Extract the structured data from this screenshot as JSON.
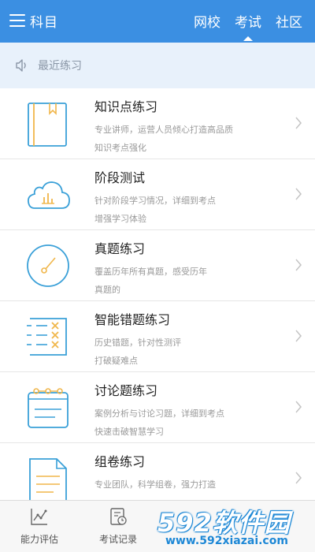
{
  "header": {
    "menu_label": "科目",
    "tabs": [
      {
        "label": "网校"
      },
      {
        "label": "考试"
      },
      {
        "label": "社区"
      }
    ],
    "active_tab": "考试",
    "accent_color": "#3b8fe2"
  },
  "recent": {
    "label": "最近练习",
    "icon": "speaker-icon"
  },
  "items": [
    {
      "title": "知识点练习",
      "desc1": "专业讲师，运营人员倾心打造高品质",
      "desc2": "知识考点强化",
      "icon": "notebook-icon"
    },
    {
      "title": "阶段测试",
      "desc1": "针对阶段学习情况，详细到考点",
      "desc2": "增强学习体验",
      "icon": "cloud-chart-icon"
    },
    {
      "title": "真题练习",
      "desc1": "覆盖历年所有真题，感受历年",
      "desc2": "真题的",
      "icon": "gauge-icon"
    },
    {
      "title": "智能错题练习",
      "desc1": "历史错题，针对性测评",
      "desc2": "打破疑难点",
      "icon": "wrong-list-icon"
    },
    {
      "title": "讨论题练习",
      "desc1": "案例分析与讨论习题，详细到考点",
      "desc2": "快速击破智慧学习",
      "icon": "binder-icon"
    },
    {
      "title": "组卷练习",
      "desc1": "专业团队，科学组卷，强力打造",
      "desc2": "",
      "icon": "document-icon"
    }
  ],
  "bottom_nav": [
    {
      "label": "能力评估",
      "icon": "chart-line-icon"
    },
    {
      "label": "考试记录",
      "icon": "record-icon"
    },
    {
      "label": "",
      "icon": ""
    },
    {
      "label": "",
      "icon": ""
    }
  ],
  "watermark": {
    "big": "592软件园",
    "small": "www.592xiazai.com"
  }
}
